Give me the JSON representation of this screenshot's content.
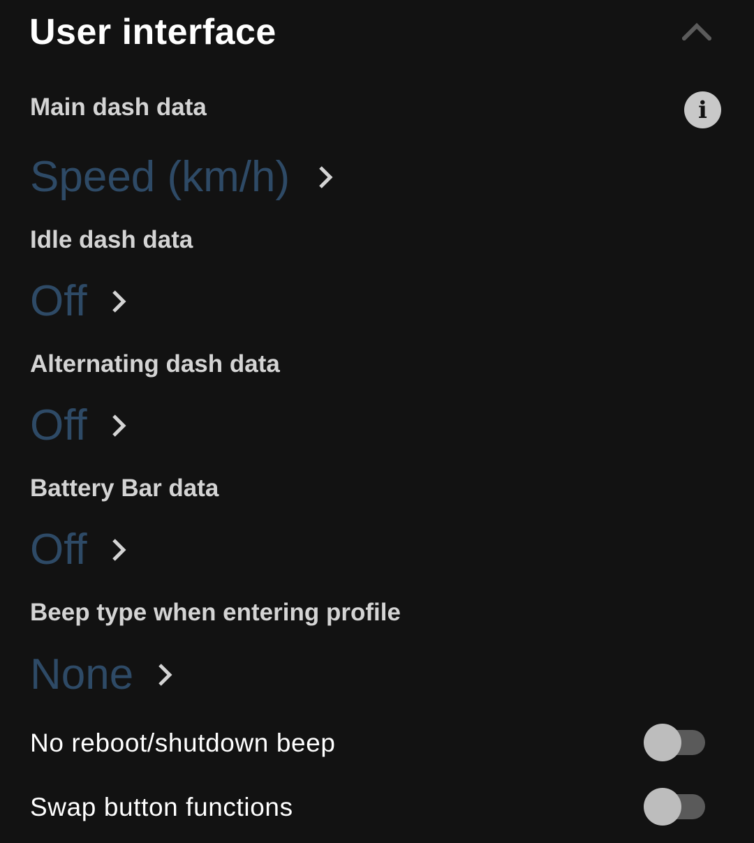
{
  "section": {
    "title": "User interface",
    "collapse_icon": "chevron-up-icon"
  },
  "main_dash": {
    "label": "Main dash data",
    "value": "Speed (km/h)",
    "info_icon": "info-icon",
    "info_glyph": "i"
  },
  "idle_dash": {
    "label": "Idle dash data",
    "value": "Off"
  },
  "alternating_dash": {
    "label": "Alternating dash data",
    "value": "Off"
  },
  "battery_bar": {
    "label": "Battery Bar data",
    "value": "Off"
  },
  "beep_type": {
    "label": "Beep type when entering profile",
    "value": "None"
  },
  "no_reboot_beep": {
    "label": "No reboot/shutdown beep",
    "enabled": false
  },
  "swap_buttons": {
    "label": "Swap button functions",
    "enabled": false
  },
  "colors": {
    "background": "#121212",
    "value_accent": "#2e4a66",
    "label_text": "#d4d4d4",
    "switch_track_off": "#5a5a5a",
    "switch_thumb_off": "#bdbdbd"
  }
}
